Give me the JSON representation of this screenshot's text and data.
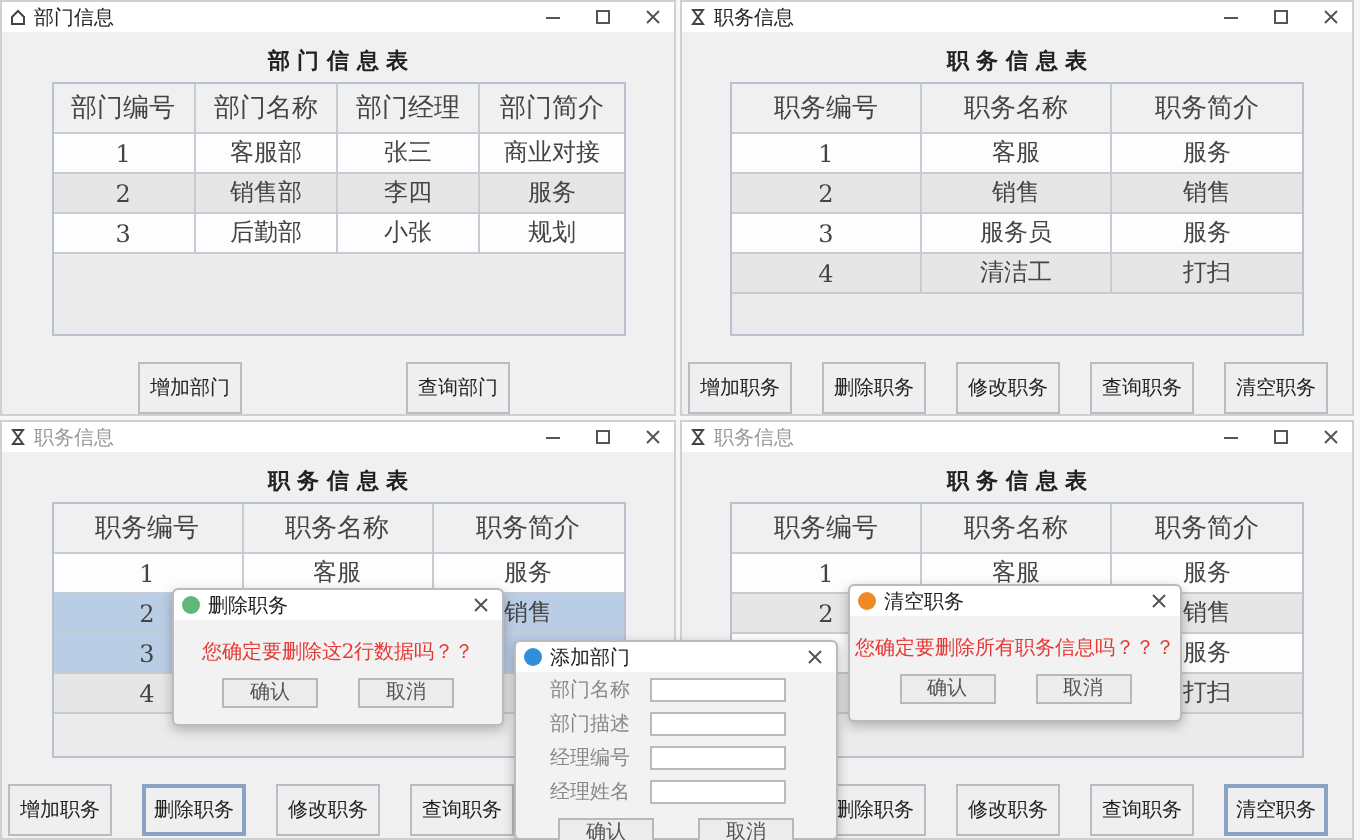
{
  "windows": [
    {
      "title": "部门信息",
      "active": true,
      "heading": "部 门 信 息 表",
      "table": {
        "columns": [
          "部门编号",
          "部门名称",
          "部门经理",
          "部门简介"
        ],
        "rows": [
          {
            "cells": [
              "1",
              "客服部",
              "张三",
              "商业对接"
            ],
            "selected": false
          },
          {
            "cells": [
              "2",
              "销售部",
              "李四",
              "服务"
            ],
            "selected": false
          },
          {
            "cells": [
              "3",
              "后勤部",
              "小张",
              "规划"
            ],
            "selected": false
          }
        ]
      },
      "buttons": [
        {
          "label": "增加部门",
          "focused": false
        },
        {
          "label": "查询部门",
          "focused": false
        }
      ]
    },
    {
      "title": "职务信息",
      "active": true,
      "heading": "职 务 信 息 表",
      "table": {
        "columns": [
          "职务编号",
          "职务名称",
          "职务简介"
        ],
        "rows": [
          {
            "cells": [
              "1",
              "客服",
              "服务"
            ],
            "selected": false
          },
          {
            "cells": [
              "2",
              "销售",
              "销售"
            ],
            "selected": false
          },
          {
            "cells": [
              "3",
              "服务员",
              "服务"
            ],
            "selected": false
          },
          {
            "cells": [
              "4",
              "清洁工",
              "打扫"
            ],
            "selected": false
          }
        ]
      },
      "buttons": [
        {
          "label": "增加职务",
          "focused": false
        },
        {
          "label": "删除职务",
          "focused": false
        },
        {
          "label": "修改职务",
          "focused": false
        },
        {
          "label": "查询职务",
          "focused": false
        },
        {
          "label": "清空职务",
          "focused": false
        }
      ]
    },
    {
      "title": "职务信息",
      "active": false,
      "heading": "职 务 信 息 表",
      "table": {
        "columns": [
          "职务编号",
          "职务名称",
          "职务简介"
        ],
        "rows": [
          {
            "cells": [
              "1",
              "客服",
              "服务"
            ],
            "selected": false
          },
          {
            "cells": [
              "2",
              null,
              "销售"
            ],
            "selected": true
          },
          {
            "cells": [
              "3",
              null,
              null
            ],
            "selected": true
          },
          {
            "cells": [
              "4",
              null,
              null
            ],
            "selected": false
          }
        ]
      },
      "buttons": [
        {
          "label": "增加职务",
          "focused": false
        },
        {
          "label": "删除职务",
          "focused": true
        },
        {
          "label": "修改职务",
          "focused": false
        },
        {
          "label": "查询职务",
          "focused": false
        }
      ]
    },
    {
      "title": "职务信息",
      "active": false,
      "heading": "职 务 信 息 表",
      "table": {
        "columns": [
          "职务编号",
          "职务名称",
          "职务简介"
        ],
        "rows": [
          {
            "cells": [
              "1",
              "客服",
              "服务"
            ],
            "selected": false
          },
          {
            "cells": [
              "2",
              null,
              "销售"
            ],
            "selected": false
          },
          {
            "cells": [
              null,
              null,
              "服务"
            ],
            "selected": false
          },
          {
            "cells": [
              null,
              null,
              "打扫"
            ],
            "selected": false
          }
        ]
      },
      "buttons": [
        {
          "label": "删除职务",
          "focused": false
        },
        {
          "label": "修改职务",
          "focused": false
        },
        {
          "label": "查询职务",
          "focused": false
        },
        {
          "label": "清空职务",
          "focused": true
        }
      ]
    }
  ],
  "dialogs": [
    {
      "kind": "confirm",
      "title": "删除职务",
      "color": "#5fb878",
      "message": "您确定要删除这2行数据吗？？",
      "buttons": [
        "确认",
        "取消"
      ]
    },
    {
      "kind": "form",
      "title": "添加部门",
      "color": "#2f8fd8",
      "fields": [
        {
          "label": "部门名称"
        },
        {
          "label": "部门描述"
        },
        {
          "label": "经理编号"
        },
        {
          "label": "经理姓名"
        }
      ],
      "buttons": [
        "确认",
        "取消"
      ]
    },
    {
      "kind": "confirm",
      "title": "清空职务",
      "color": "#f08a24",
      "message": "您确定要删除所有职务信息吗？？？",
      "buttons": [
        "确认",
        "取消"
      ]
    }
  ]
}
